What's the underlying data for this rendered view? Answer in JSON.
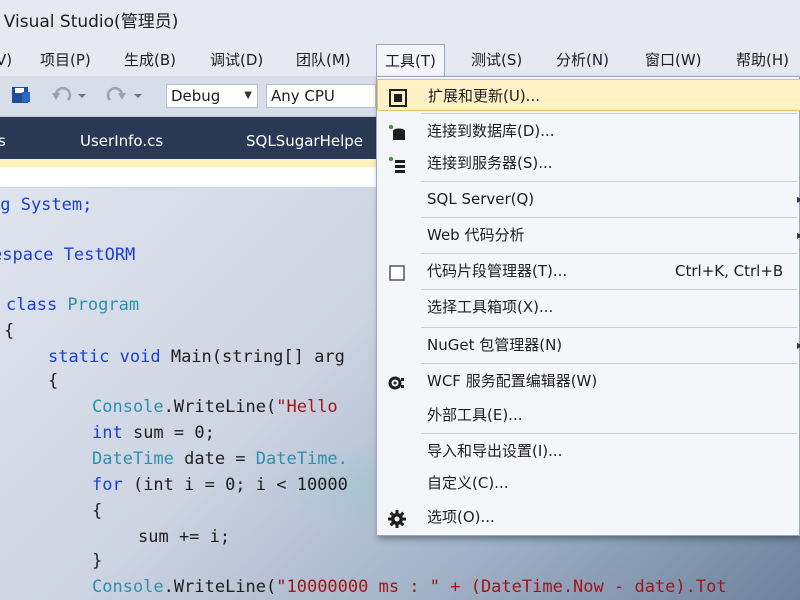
{
  "window": {
    "title": "ft Visual Studio(管理员)"
  },
  "menubar": {
    "items": [
      {
        "label": "V)"
      },
      {
        "label": "项目(P)"
      },
      {
        "label": "生成(B)"
      },
      {
        "label": "调试(D)"
      },
      {
        "label": "团队(M)"
      },
      {
        "label": "工具(T)"
      },
      {
        "label": "测试(S)"
      },
      {
        "label": "分析(N)"
      },
      {
        "label": "窗口(W)"
      },
      {
        "label": "帮助(H)"
      }
    ]
  },
  "toolbar": {
    "config_value": "Debug",
    "platform_value": "Any CPU"
  },
  "tabs": [
    {
      "label": "s"
    },
    {
      "label": "UserInfo.cs"
    },
    {
      "label": "SQLSugarHelpe"
    }
  ],
  "code": {
    "lines": [
      {
        "a": "ng System;",
        "b": "",
        "c": ""
      },
      {
        "a": "espace TestORM",
        "b": "",
        "c": ""
      },
      {
        "a": "class ",
        "b": "Program",
        "c": ""
      },
      {
        "a": "{",
        "b": "",
        "c": ""
      },
      {
        "a": "static void ",
        "b": "Main(string[] arg",
        "c": ""
      },
      {
        "a": "{",
        "b": "",
        "c": ""
      },
      {
        "a": "Console",
        "b": ".WriteLine(",
        "c": "\"Hello"
      },
      {
        "a": "int",
        "b": " sum = 0;",
        "c": ""
      },
      {
        "a": "DateTime",
        "b": " date = ",
        "c": "DateTime."
      },
      {
        "a": "for",
        "b": " (int i = 0; i < 10000",
        "c": ""
      },
      {
        "a": "{",
        "b": "",
        "c": ""
      },
      {
        "a": "sum += i;",
        "b": "",
        "c": ""
      },
      {
        "a": "}",
        "b": "",
        "c": ""
      },
      {
        "a": "Console",
        "b": ".WriteLine(",
        "c": "\"10000000 ms : \" + (DateTime.Now - date).Tot"
      }
    ]
  },
  "tools_menu": {
    "items": [
      {
        "label": "扩展和更新(U)...",
        "shortcut": "",
        "icon": "extensions-icon",
        "submenu": false
      },
      {
        "label": "连接到数据库(D)...",
        "shortcut": "",
        "icon": "database-connect-icon",
        "submenu": false
      },
      {
        "label": "连接到服务器(S)...",
        "shortcut": "",
        "icon": "server-connect-icon",
        "submenu": false
      },
      {
        "label": "SQL Server(Q)",
        "shortcut": "",
        "icon": "",
        "submenu": true
      },
      {
        "label": "Web 代码分析",
        "shortcut": "",
        "icon": "",
        "submenu": true
      },
      {
        "label": "代码片段管理器(T)...",
        "shortcut": "Ctrl+K, Ctrl+B",
        "icon": "snippet-icon",
        "submenu": false
      },
      {
        "label": "选择工具箱项(X)...",
        "shortcut": "",
        "icon": "",
        "submenu": false
      },
      {
        "label": "NuGet 包管理器(N)",
        "shortcut": "",
        "icon": "",
        "submenu": true
      },
      {
        "label": "WCF 服务配置编辑器(W)",
        "shortcut": "",
        "icon": "wcf-config-icon",
        "submenu": false
      },
      {
        "label": "外部工具(E)...",
        "shortcut": "",
        "icon": "",
        "submenu": false
      },
      {
        "label": "导入和导出设置(I)...",
        "shortcut": "",
        "icon": "",
        "submenu": false
      },
      {
        "label": "自定义(C)...",
        "shortcut": "",
        "icon": "",
        "submenu": false
      },
      {
        "label": "选项(O)...",
        "shortcut": "",
        "icon": "gear-icon",
        "submenu": false
      }
    ],
    "submenu_glyph": "▸"
  },
  "colors": {
    "tab_strip": "#293955",
    "menu_highlight": "#fff1c4",
    "keyword": "#1a3fd6",
    "type": "#2b91af",
    "string": "#a31515"
  }
}
